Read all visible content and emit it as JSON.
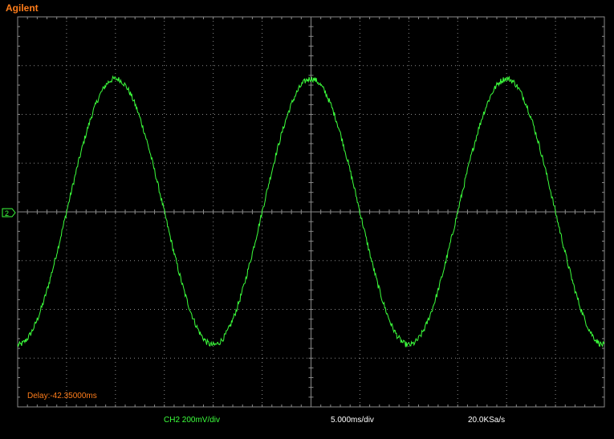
{
  "brand": "Agilent",
  "channel_marker": "2",
  "delay_label": "Delay:-42.35000ms",
  "status": {
    "channel": "CH2 200mV/div",
    "timebase": "5.000ms/div",
    "sample_rate": "20.0KSa/s"
  },
  "colors": {
    "trace": "#3cff3c",
    "brand": "#ff7d1a",
    "grid": "#8a8a8a",
    "background": "#000000"
  },
  "chart_data": {
    "type": "line",
    "divisions": {
      "x": 12,
      "y": 8
    },
    "x_unit": "ms",
    "ms_per_div": 5.0,
    "mv_per_div": 200,
    "waveform": "sine",
    "period_div": 4.0,
    "phase_peak_div": 2.0,
    "amplitude_div": 2.73,
    "offset_div": 0.0
  }
}
